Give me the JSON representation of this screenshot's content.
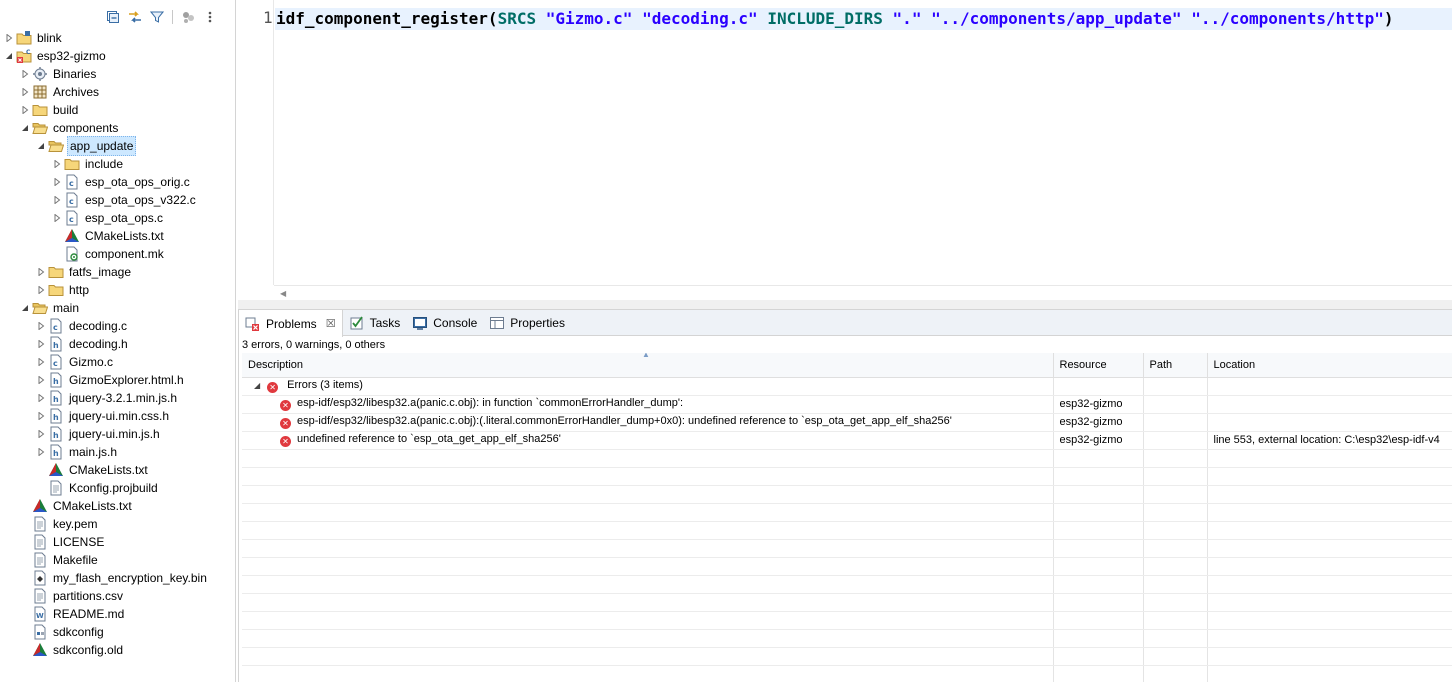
{
  "explorer": {
    "toolbar": [
      "collapse-all-icon",
      "link-with-editor-icon",
      "filter-icon",
      "focus-icon",
      "view-menu-icon"
    ],
    "items": [
      {
        "label": "blink",
        "level": 0,
        "twisty": "collapsed",
        "icon": "project-icon"
      },
      {
        "label": "esp32-gizmo",
        "level": 0,
        "twisty": "expanded",
        "icon": "project-error-icon"
      },
      {
        "label": "Binaries",
        "level": 1,
        "twisty": "collapsed",
        "icon": "binaries-icon"
      },
      {
        "label": "Archives",
        "level": 1,
        "twisty": "collapsed",
        "icon": "archives-icon"
      },
      {
        "label": "build",
        "level": 1,
        "twisty": "collapsed",
        "icon": "folder-icon"
      },
      {
        "label": "components",
        "level": 1,
        "twisty": "expanded",
        "icon": "folder-open-icon"
      },
      {
        "label": "app_update",
        "level": 2,
        "twisty": "expanded",
        "icon": "folder-open-icon",
        "selected": true
      },
      {
        "label": "include",
        "level": 3,
        "twisty": "collapsed",
        "icon": "folder-icon"
      },
      {
        "label": "esp_ota_ops_orig.c",
        "level": 3,
        "twisty": "collapsed",
        "icon": "c-file-icon"
      },
      {
        "label": "esp_ota_ops_v322.c",
        "level": 3,
        "twisty": "collapsed",
        "icon": "c-file-icon"
      },
      {
        "label": "esp_ota_ops.c",
        "level": 3,
        "twisty": "collapsed",
        "icon": "c-file-icon"
      },
      {
        "label": "CMakeLists.txt",
        "level": 3,
        "twisty": "none",
        "icon": "cmake-icon"
      },
      {
        "label": "component.mk",
        "level": 3,
        "twisty": "none",
        "icon": "makefile-icon"
      },
      {
        "label": "fatfs_image",
        "level": 2,
        "twisty": "collapsed",
        "icon": "folder-icon"
      },
      {
        "label": "http",
        "level": 2,
        "twisty": "collapsed",
        "icon": "folder-icon"
      },
      {
        "label": "main",
        "level": 1,
        "twisty": "expanded",
        "icon": "folder-open-icon"
      },
      {
        "label": "decoding.c",
        "level": 2,
        "twisty": "collapsed",
        "icon": "c-file-icon"
      },
      {
        "label": "decoding.h",
        "level": 2,
        "twisty": "collapsed",
        "icon": "h-file-icon"
      },
      {
        "label": "Gizmo.c",
        "level": 2,
        "twisty": "collapsed",
        "icon": "c-file-icon"
      },
      {
        "label": "GizmoExplorer.html.h",
        "level": 2,
        "twisty": "collapsed",
        "icon": "h-file-icon"
      },
      {
        "label": "jquery-3.2.1.min.js.h",
        "level": 2,
        "twisty": "collapsed",
        "icon": "h-file-icon"
      },
      {
        "label": "jquery-ui.min.css.h",
        "level": 2,
        "twisty": "collapsed",
        "icon": "h-file-icon"
      },
      {
        "label": "jquery-ui.min.js.h",
        "level": 2,
        "twisty": "collapsed",
        "icon": "h-file-icon"
      },
      {
        "label": "main.js.h",
        "level": 2,
        "twisty": "collapsed",
        "icon": "h-file-icon"
      },
      {
        "label": "CMakeLists.txt",
        "level": 2,
        "twisty": "none",
        "icon": "cmake-icon"
      },
      {
        "label": "Kconfig.projbuild",
        "level": 2,
        "twisty": "none",
        "icon": "text-file-icon"
      },
      {
        "label": "CMakeLists.txt",
        "level": 1,
        "twisty": "none",
        "icon": "cmake-icon"
      },
      {
        "label": "key.pem",
        "level": 1,
        "twisty": "none",
        "icon": "text-file-icon"
      },
      {
        "label": "LICENSE",
        "level": 1,
        "twisty": "none",
        "icon": "text-file-icon"
      },
      {
        "label": "Makefile",
        "level": 1,
        "twisty": "none",
        "icon": "text-file-icon"
      },
      {
        "label": "my_flash_encryption_key.bin",
        "level": 1,
        "twisty": "none",
        "icon": "binary-file-icon"
      },
      {
        "label": "partitions.csv",
        "level": 1,
        "twisty": "none",
        "icon": "text-file-icon"
      },
      {
        "label": "README.md",
        "level": 1,
        "twisty": "none",
        "icon": "markdown-file-icon"
      },
      {
        "label": "sdkconfig",
        "level": 1,
        "twisty": "none",
        "icon": "config-file-icon"
      },
      {
        "label": "sdkconfig.old",
        "level": 1,
        "twisty": "none",
        "icon": "cmake-icon"
      }
    ]
  },
  "editor": {
    "line_number": "1",
    "tokens": [
      {
        "text": "idf_component_register(",
        "kind": "fn"
      },
      {
        "text": "SRCS",
        "kind": "kw"
      },
      {
        "text": " ",
        "kind": "fn"
      },
      {
        "text": "\"Gizmo.c\"",
        "kind": "str"
      },
      {
        "text": " ",
        "kind": "fn"
      },
      {
        "text": "\"decoding.c\"",
        "kind": "str"
      },
      {
        "text": " ",
        "kind": "fn"
      },
      {
        "text": "INCLUDE_DIRS",
        "kind": "kw"
      },
      {
        "text": " ",
        "kind": "fn"
      },
      {
        "text": "\".\"",
        "kind": "str"
      },
      {
        "text": " ",
        "kind": "fn"
      },
      {
        "text": "\"../components/app_update\"",
        "kind": "str"
      },
      {
        "text": " ",
        "kind": "fn"
      },
      {
        "text": "\"../components/http\"",
        "kind": "str"
      },
      {
        "text": ")",
        "kind": "fn"
      }
    ]
  },
  "panel": {
    "tabs": [
      {
        "label": "Problems",
        "icon": "problems-icon",
        "active": true,
        "closable": true
      },
      {
        "label": "Tasks",
        "icon": "tasks-icon",
        "active": false
      },
      {
        "label": "Console",
        "icon": "console-icon",
        "active": false
      },
      {
        "label": "Properties",
        "icon": "properties-icon",
        "active": false
      }
    ],
    "summary": "3 errors, 0 warnings, 0 others",
    "columns": [
      "Description",
      "Resource",
      "Path",
      "Location"
    ],
    "group_label": "Errors (3 items)",
    "rows": [
      {
        "description": "esp-idf/esp32/libesp32.a(panic.c.obj): in function `commonErrorHandler_dump':",
        "resource": "esp32-gizmo",
        "path": "",
        "location": ""
      },
      {
        "description": "esp-idf/esp32/libesp32.a(panic.c.obj):(.literal.commonErrorHandler_dump+0x0): undefined reference to `esp_ota_get_app_elf_sha256'",
        "resource": "esp32-gizmo",
        "path": "",
        "location": ""
      },
      {
        "description": "undefined reference to `esp_ota_get_app_elf_sha256'",
        "resource": "esp32-gizmo",
        "path": "",
        "location": "line 553, external location: C:\\esp32\\esp-idf-v4"
      }
    ],
    "empty_rows": 13
  }
}
